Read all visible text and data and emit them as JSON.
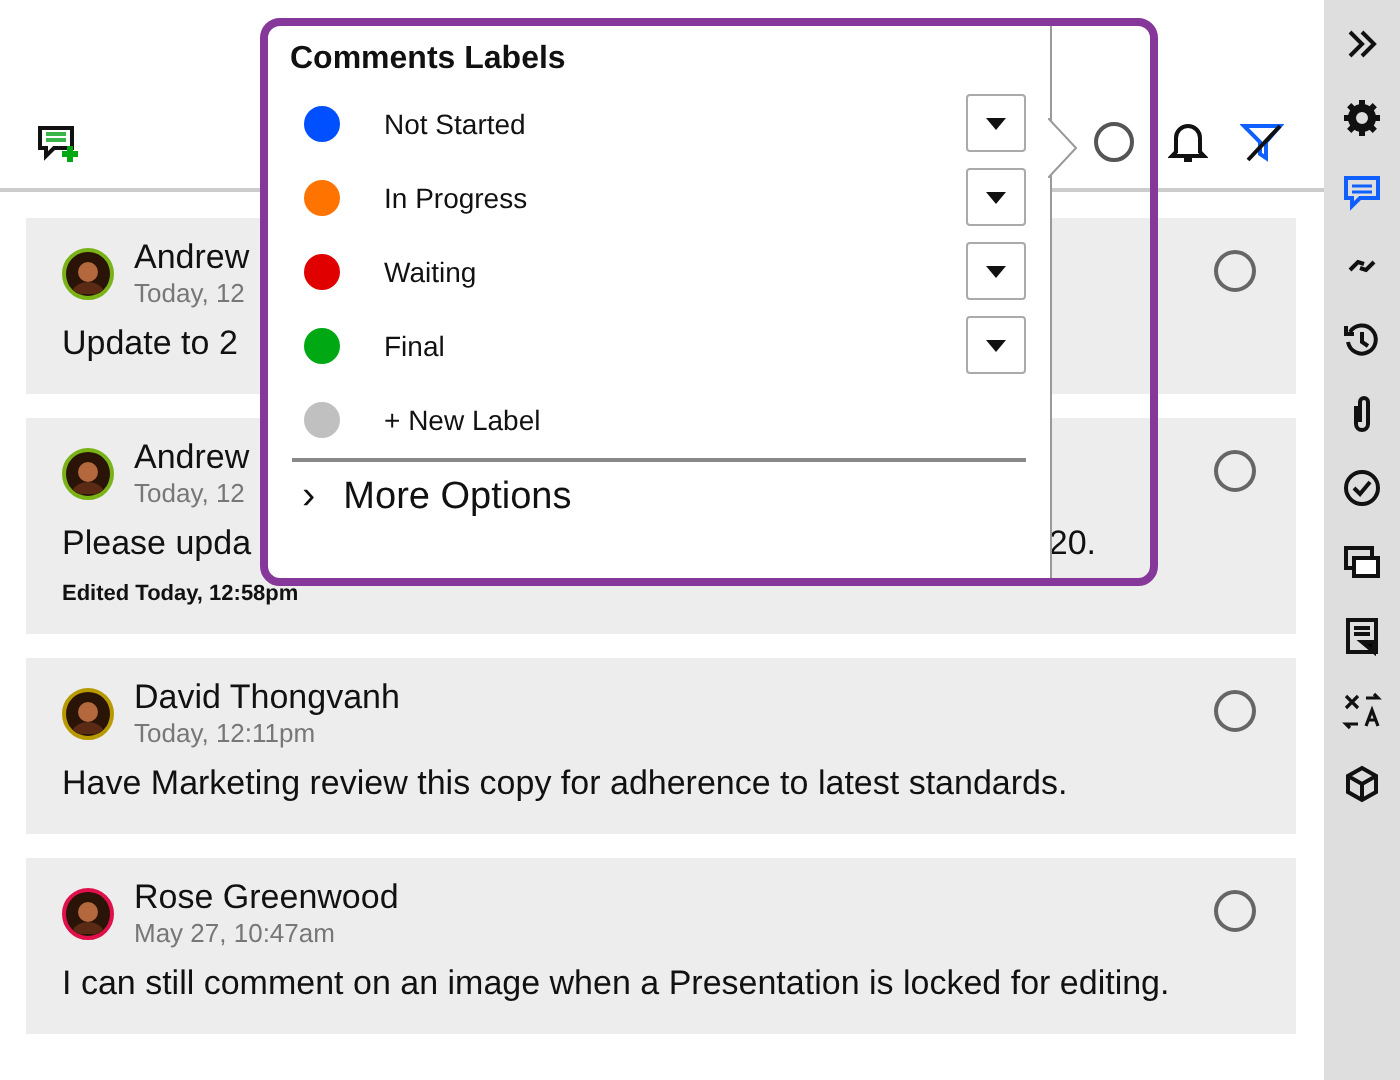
{
  "popup": {
    "title": "Comments Labels",
    "labels": [
      {
        "kind": "label",
        "name": "Not Started",
        "color": "#0050ff"
      },
      {
        "kind": "label",
        "name": "In Progress",
        "color": "#ff7300"
      },
      {
        "kind": "label",
        "name": "Waiting",
        "color": "#e00000"
      },
      {
        "kind": "label",
        "name": "Final",
        "color": "#00a814"
      },
      {
        "kind": "new",
        "name": "+ New Label",
        "color": "#c0c0c0"
      }
    ],
    "more_options": {
      "chevron": "›",
      "label": "More Options"
    }
  },
  "comments": [
    {
      "author": "Andrew",
      "time": "Today, 12",
      "body": "Update to 2",
      "color": "#7ab317",
      "resolved": false
    },
    {
      "author": "Andrew",
      "time": "Today, 12",
      "body": "Please upda",
      "body_end": "20.",
      "edited": "Edited Today, 12:58pm",
      "color": "#7ab317",
      "resolved": false
    },
    {
      "author": "David Thongvanh",
      "time": "Today, 12:11pm",
      "body": "Have Marketing review this copy for adherence to latest standards.",
      "color": "#b89a00",
      "resolved": false
    },
    {
      "author": "Rose Greenwood",
      "time": "May 27, 10:47am",
      "body": "I can still comment on an image when a Presentation is locked for editing.",
      "color": "#e0104a",
      "resolved": false
    }
  ]
}
